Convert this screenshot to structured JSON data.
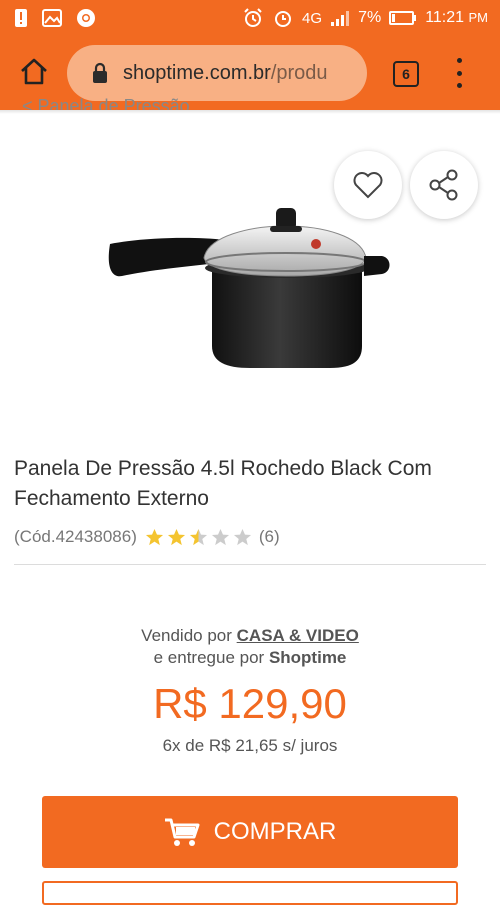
{
  "status_bar": {
    "battery": "7%",
    "time": "11:21",
    "ampm": "PM",
    "network": "4G"
  },
  "browser": {
    "url_host": "shoptime.com.br",
    "url_path": "/produ",
    "tab_count": "6"
  },
  "breadcrumb": "< Panela de Pressão",
  "product": {
    "title": "Panela De Pressão 4.5l Rochedo Black Com Fechamento Externo",
    "code": "(Cód.42438086)",
    "rating": 2.5,
    "rating_max": 5,
    "review_count": "(6)"
  },
  "seller": {
    "sold_by_prefix": "Vendido por",
    "sold_by_name": "CASA & VIDEO",
    "delivered_by_prefix": "e entregue por",
    "delivered_by_name": "Shoptime"
  },
  "price": {
    "value": "R$ 129,90",
    "installments": "6x de R$ 21,65 s/ juros"
  },
  "actions": {
    "buy_label": "COMPRAR"
  },
  "colors": {
    "brand_orange": "#f26a21",
    "star_gold": "#f4c430",
    "star_gray": "#cccccc"
  }
}
